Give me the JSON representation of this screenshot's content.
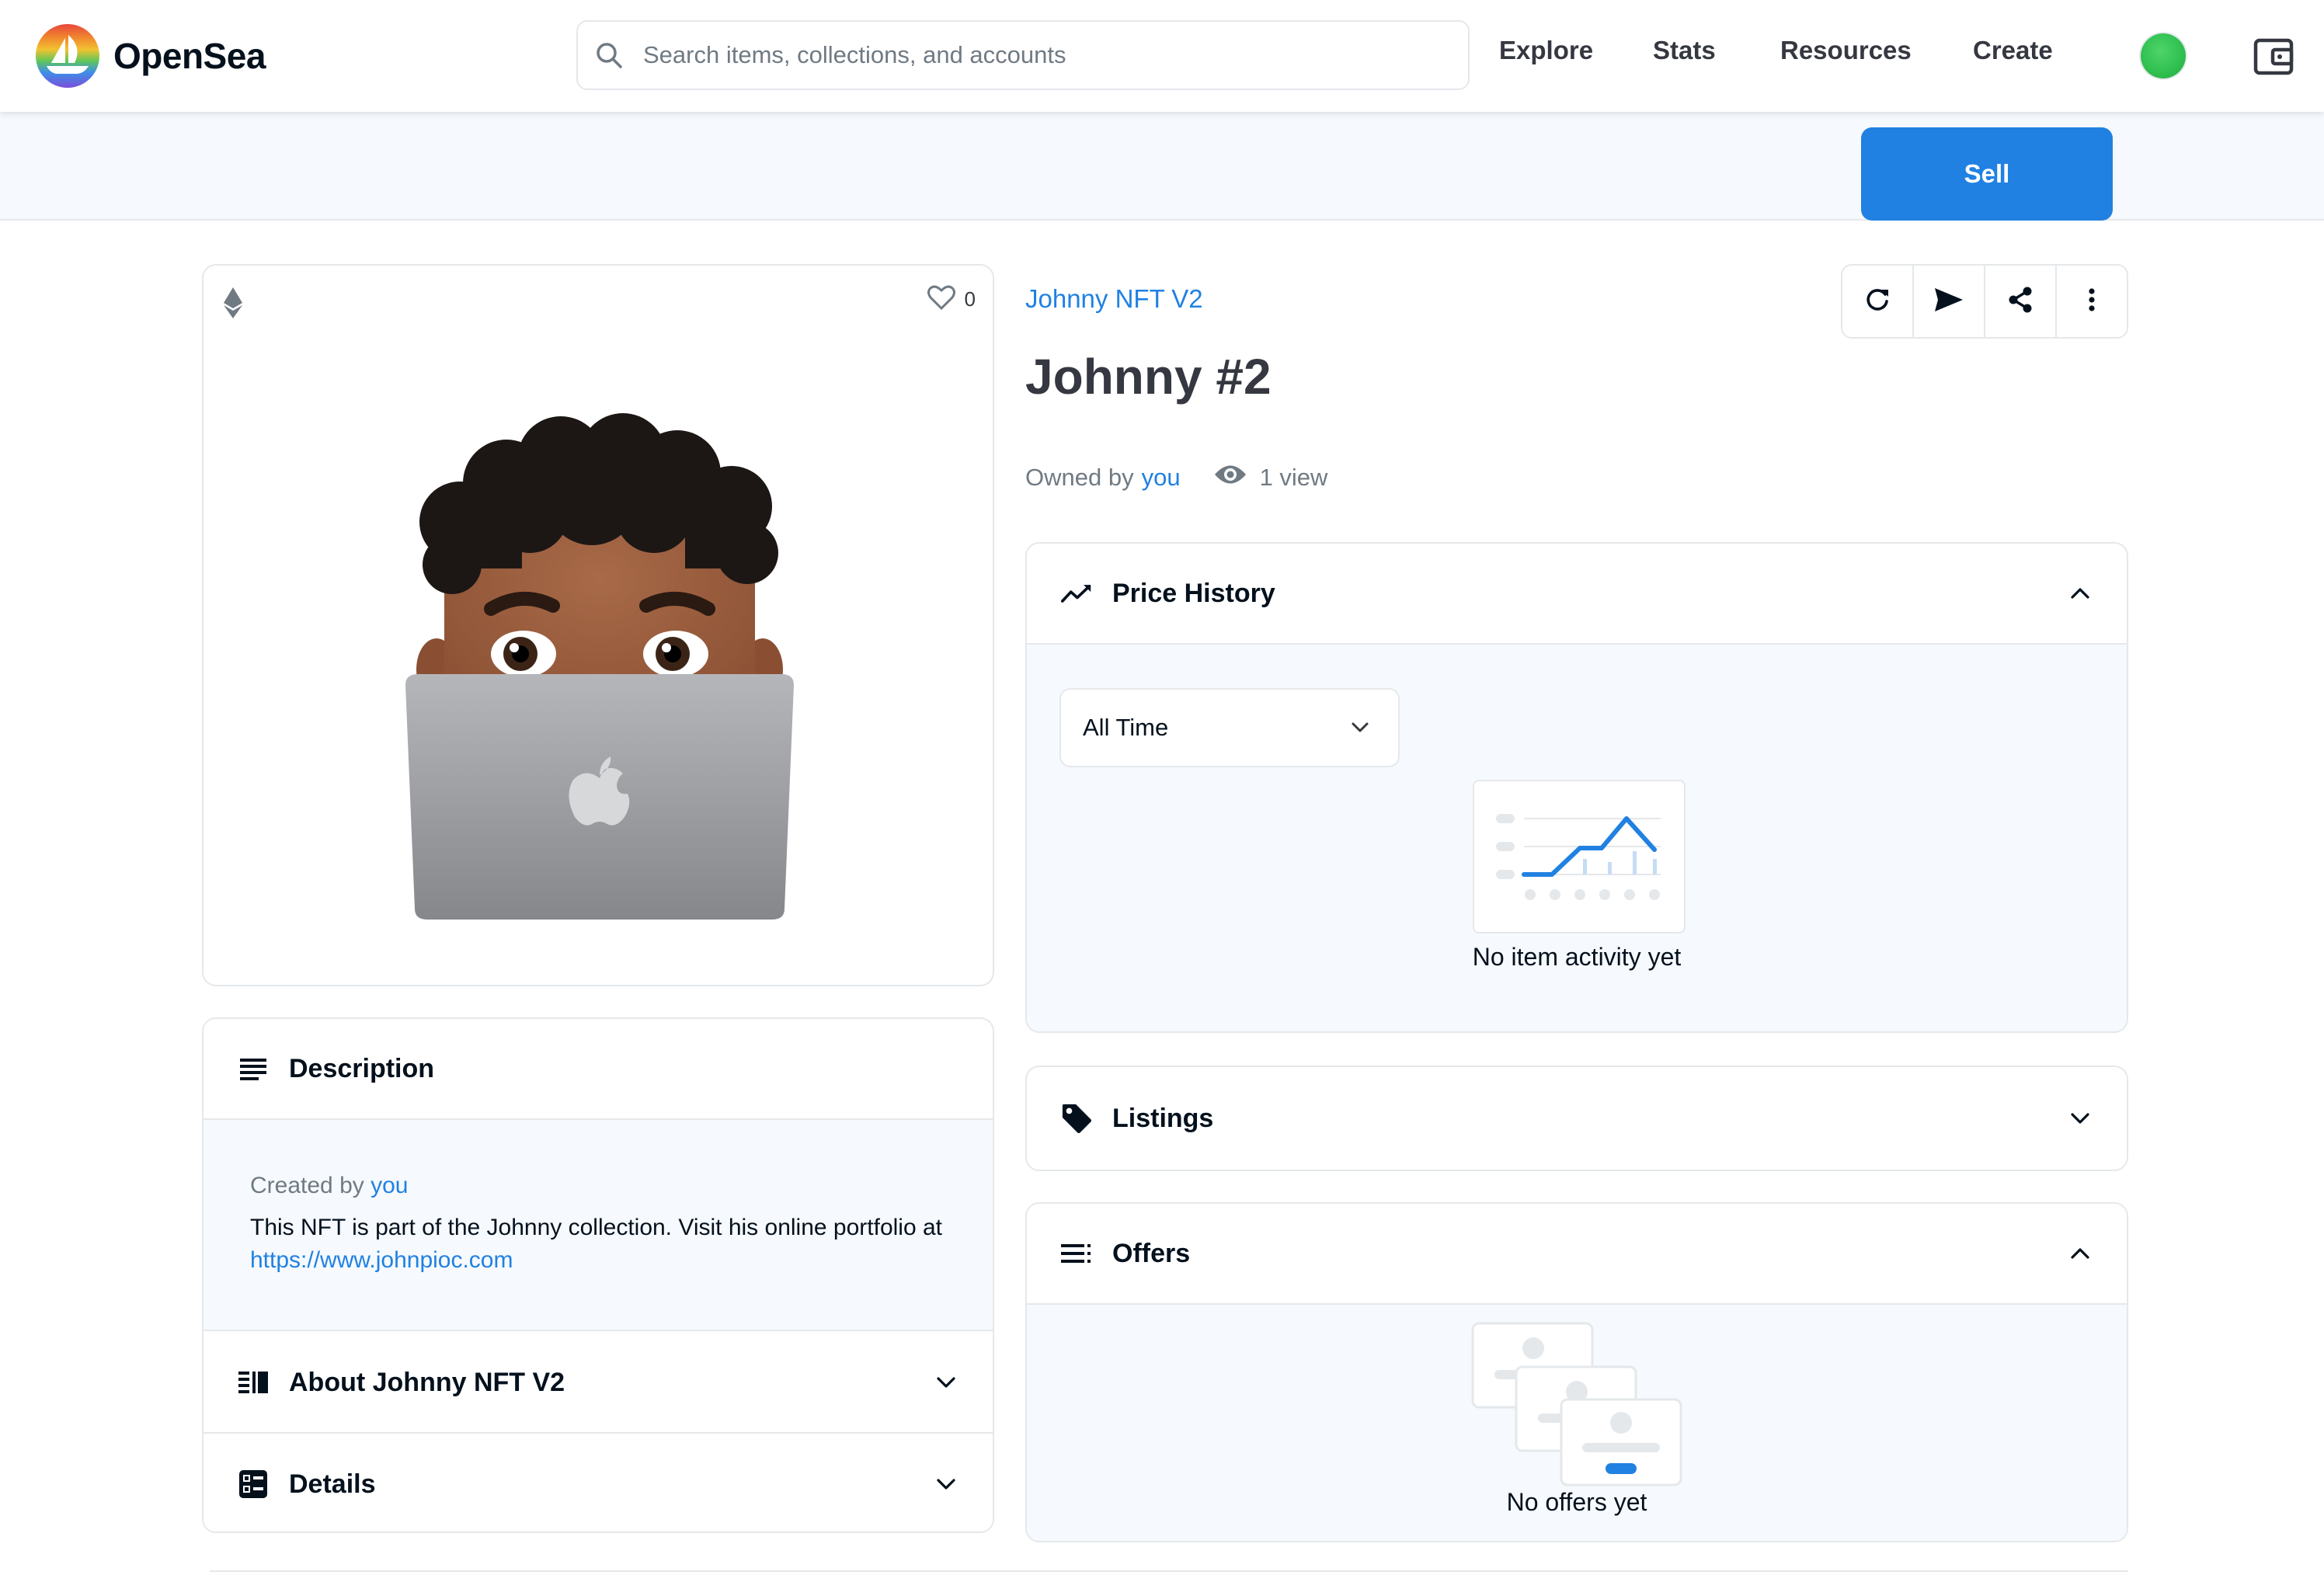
{
  "header": {
    "brand": "OpenSea",
    "search_placeholder": "Search items, collections, and accounts",
    "nav": {
      "explore": "Explore",
      "stats": "Stats",
      "resources": "Resources",
      "create": "Create"
    },
    "icons": [
      "opensea-logo-icon",
      "search-icon",
      "account-avatar-icon",
      "wallet-icon"
    ]
  },
  "sellbar": {
    "sell_label": "Sell"
  },
  "media": {
    "chain_icon": "ethereum-icon",
    "favorites_count": "0",
    "image_description": "memoji-behind-laptop"
  },
  "description": {
    "title": "Description",
    "created_by_prefix": "Created by",
    "created_by_user": "you",
    "text": "This NFT is part of the Johnny collection. Visit his online portfolio at",
    "portfolio_url": "https://www.johnpioc.com"
  },
  "about": {
    "title": "About Johnny NFT V2"
  },
  "details": {
    "title": "Details"
  },
  "item": {
    "collection": "Johnny NFT V2",
    "name": "Johnny #2",
    "owned_by_prefix": "Owned by",
    "owner": "you",
    "views": "1 view"
  },
  "actions": [
    "refresh-icon",
    "transfer-icon",
    "share-icon",
    "more-options-icon"
  ],
  "price_history": {
    "title": "Price History",
    "range_selected": "All Time",
    "empty_text": "No item activity yet"
  },
  "listings": {
    "title": "Listings"
  },
  "offers": {
    "title": "Offers",
    "empty_text": "No offers yet"
  },
  "colors": {
    "accent": "#2081e2",
    "text_primary": "#04111d",
    "text_secondary": "#707a83",
    "border": "#e5e8eb",
    "panel_bg": "#f6f9fd"
  }
}
